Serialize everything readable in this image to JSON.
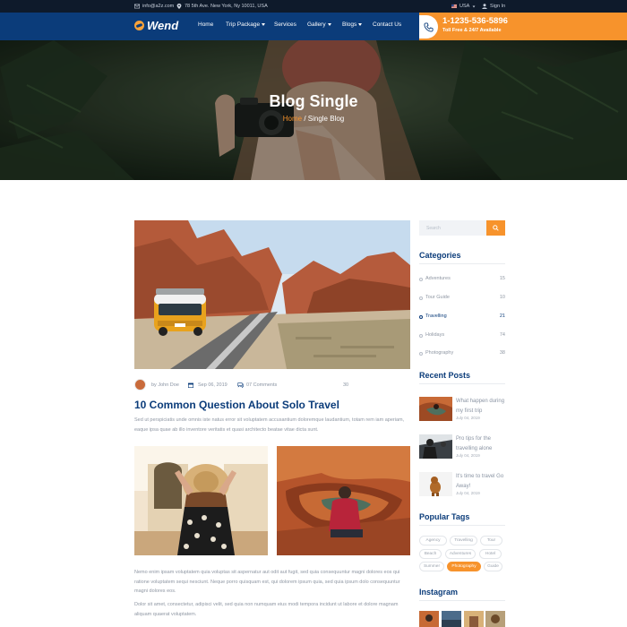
{
  "topbar": {
    "email": "info@a2z.com",
    "address": "78 5th Ave. New York, Ny 10011, USA",
    "language": "USA",
    "signin": "Sign In"
  },
  "brand": {
    "logo": "Wend"
  },
  "nav": {
    "items": [
      {
        "label": "Home",
        "dropdown": false
      },
      {
        "label": "Trip Package",
        "dropdown": true
      },
      {
        "label": "Services",
        "dropdown": false
      },
      {
        "label": "Gallery",
        "dropdown": true
      },
      {
        "label": "Blogs",
        "dropdown": true
      },
      {
        "label": "Contact Us",
        "dropdown": false
      }
    ],
    "phone": "1-1235-536-5896",
    "phone_sub": "Toll Free & 24/7 Available"
  },
  "hero": {
    "title": "Blog Single",
    "crumb_home": "Home",
    "crumb_sep": " / ",
    "crumb_current": "Single Blog"
  },
  "post": {
    "author": "by John Doe",
    "date": "Sep 06, 2019",
    "comments": "07 Comments",
    "likes": "30",
    "title": "10 Common Question About Solo Travel",
    "intro": "Sed ut perspiciatis unde omnis iste natus error sit voluptatem accusantium doloremque laudantium, totam rem iam aperiam, eaque ipsa quae ab illo inventore veritatis et quasi architecto beatae vitae dicta sunt.",
    "body1": "Nemo enim ipsam voluptatem quia voluptas sit aspernatur aut odit aut fugit, sed quia consequuntur magni dolores eos qui ratione voluptatem sequi nesciunt. Neque porro quisquam est, qui dolorem ipsum quia, sed quia ipsum dolo consequuntur magni dolores eos.",
    "body2": "Dolor sit amet, consectetur, adipisci velit, sed quia non numquam eius modi tempora incidunt ut labore et dolore magnam aliquam quaerat voluptatem."
  },
  "sidebar": {
    "search_placeholder": "Search",
    "categories_title": "Categories",
    "categories": [
      {
        "name": "Adventures",
        "count": "15"
      },
      {
        "name": "Tour Guide",
        "count": "10"
      },
      {
        "name": "Travelling",
        "count": "21"
      },
      {
        "name": "Holidays",
        "count": "74"
      },
      {
        "name": "Photography",
        "count": "38"
      }
    ],
    "recent_title": "Recent Posts",
    "recent": [
      {
        "title": "What happen during my first trip",
        "date": "July 04, 2019"
      },
      {
        "title": "Pro tips for the travelling alone",
        "date": "July 04, 2019"
      },
      {
        "title": "It's time to travel Go Away!",
        "date": "July 04, 2019"
      }
    ],
    "tags_title": "Popular Tags",
    "tags": [
      "Agency",
      "Travelling",
      "Tour",
      "Beach",
      "Adventures",
      "Hotel",
      "Summer",
      "Photography",
      "Guide"
    ],
    "instagram_title": "Instagram"
  },
  "colors": {
    "navy": "#0b3c7a",
    "orange": "#f7932c",
    "topbar": "#0e1a2b"
  },
  "icons": [
    "mail-icon",
    "location-icon",
    "flag-icon",
    "user-icon",
    "phone-icon",
    "search-icon",
    "calendar-icon",
    "comment-icon"
  ]
}
